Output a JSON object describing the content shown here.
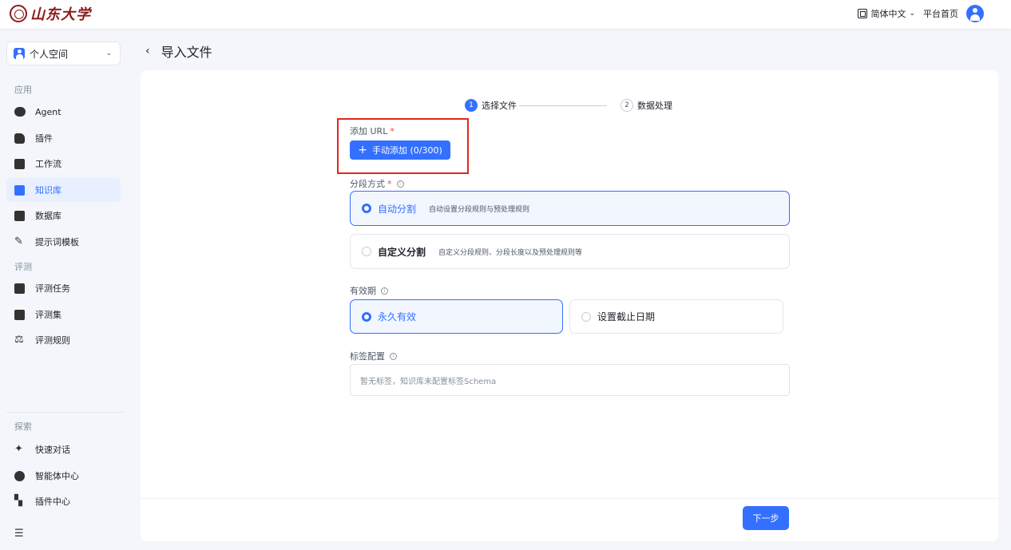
{
  "header": {
    "logo_text": "山东大学",
    "language": "简体中文",
    "home_link": "平台首页"
  },
  "sidebar": {
    "space": "个人空间",
    "section_apps": "应用",
    "apps": [
      {
        "label": "Agent",
        "icon": "robot-icon"
      },
      {
        "label": "插件",
        "icon": "puzzle-icon"
      },
      {
        "label": "工作流",
        "icon": "workflow-icon"
      },
      {
        "label": "知识库",
        "icon": "bookmark-icon",
        "active": true
      },
      {
        "label": "数据库",
        "icon": "database-icon"
      },
      {
        "label": "提示词模板",
        "icon": "magic-wand-icon"
      }
    ],
    "section_eval": "评测",
    "eval": [
      {
        "label": "评测任务",
        "icon": "task-icon"
      },
      {
        "label": "评测集",
        "icon": "dataset-icon"
      },
      {
        "label": "评测规则",
        "icon": "scale-icon"
      }
    ],
    "section_explore": "探索",
    "explore": [
      {
        "label": "快速对话",
        "icon": "sparkle-icon"
      },
      {
        "label": "智能体中心",
        "icon": "agent-hub-icon"
      },
      {
        "label": "插件中心",
        "icon": "plugin-hub-icon"
      }
    ]
  },
  "main": {
    "title": "导入文件",
    "steps": [
      {
        "num": "1",
        "label": "选择文件"
      },
      {
        "num": "2",
        "label": "数据处理"
      }
    ],
    "add_url_label": "添加 URL",
    "add_button": "手动添加 (0/300)",
    "segment_label": "分段方式",
    "segment_options": [
      {
        "title": "自动分割",
        "desc": "自动设置分段规则与预处理规则"
      },
      {
        "title": "自定义分割",
        "desc": "自定义分段规则、分段长度以及预处理规则等"
      }
    ],
    "validity_label": "有效期",
    "validity_options": [
      "永久有效",
      "设置截止日期"
    ],
    "tag_label": "标签配置",
    "tag_placeholder": "暂无标签，知识库未配置标签Schema",
    "next_button": "下一步"
  },
  "colors": {
    "accent": "#3370ff",
    "highlight": "#e3261b"
  }
}
